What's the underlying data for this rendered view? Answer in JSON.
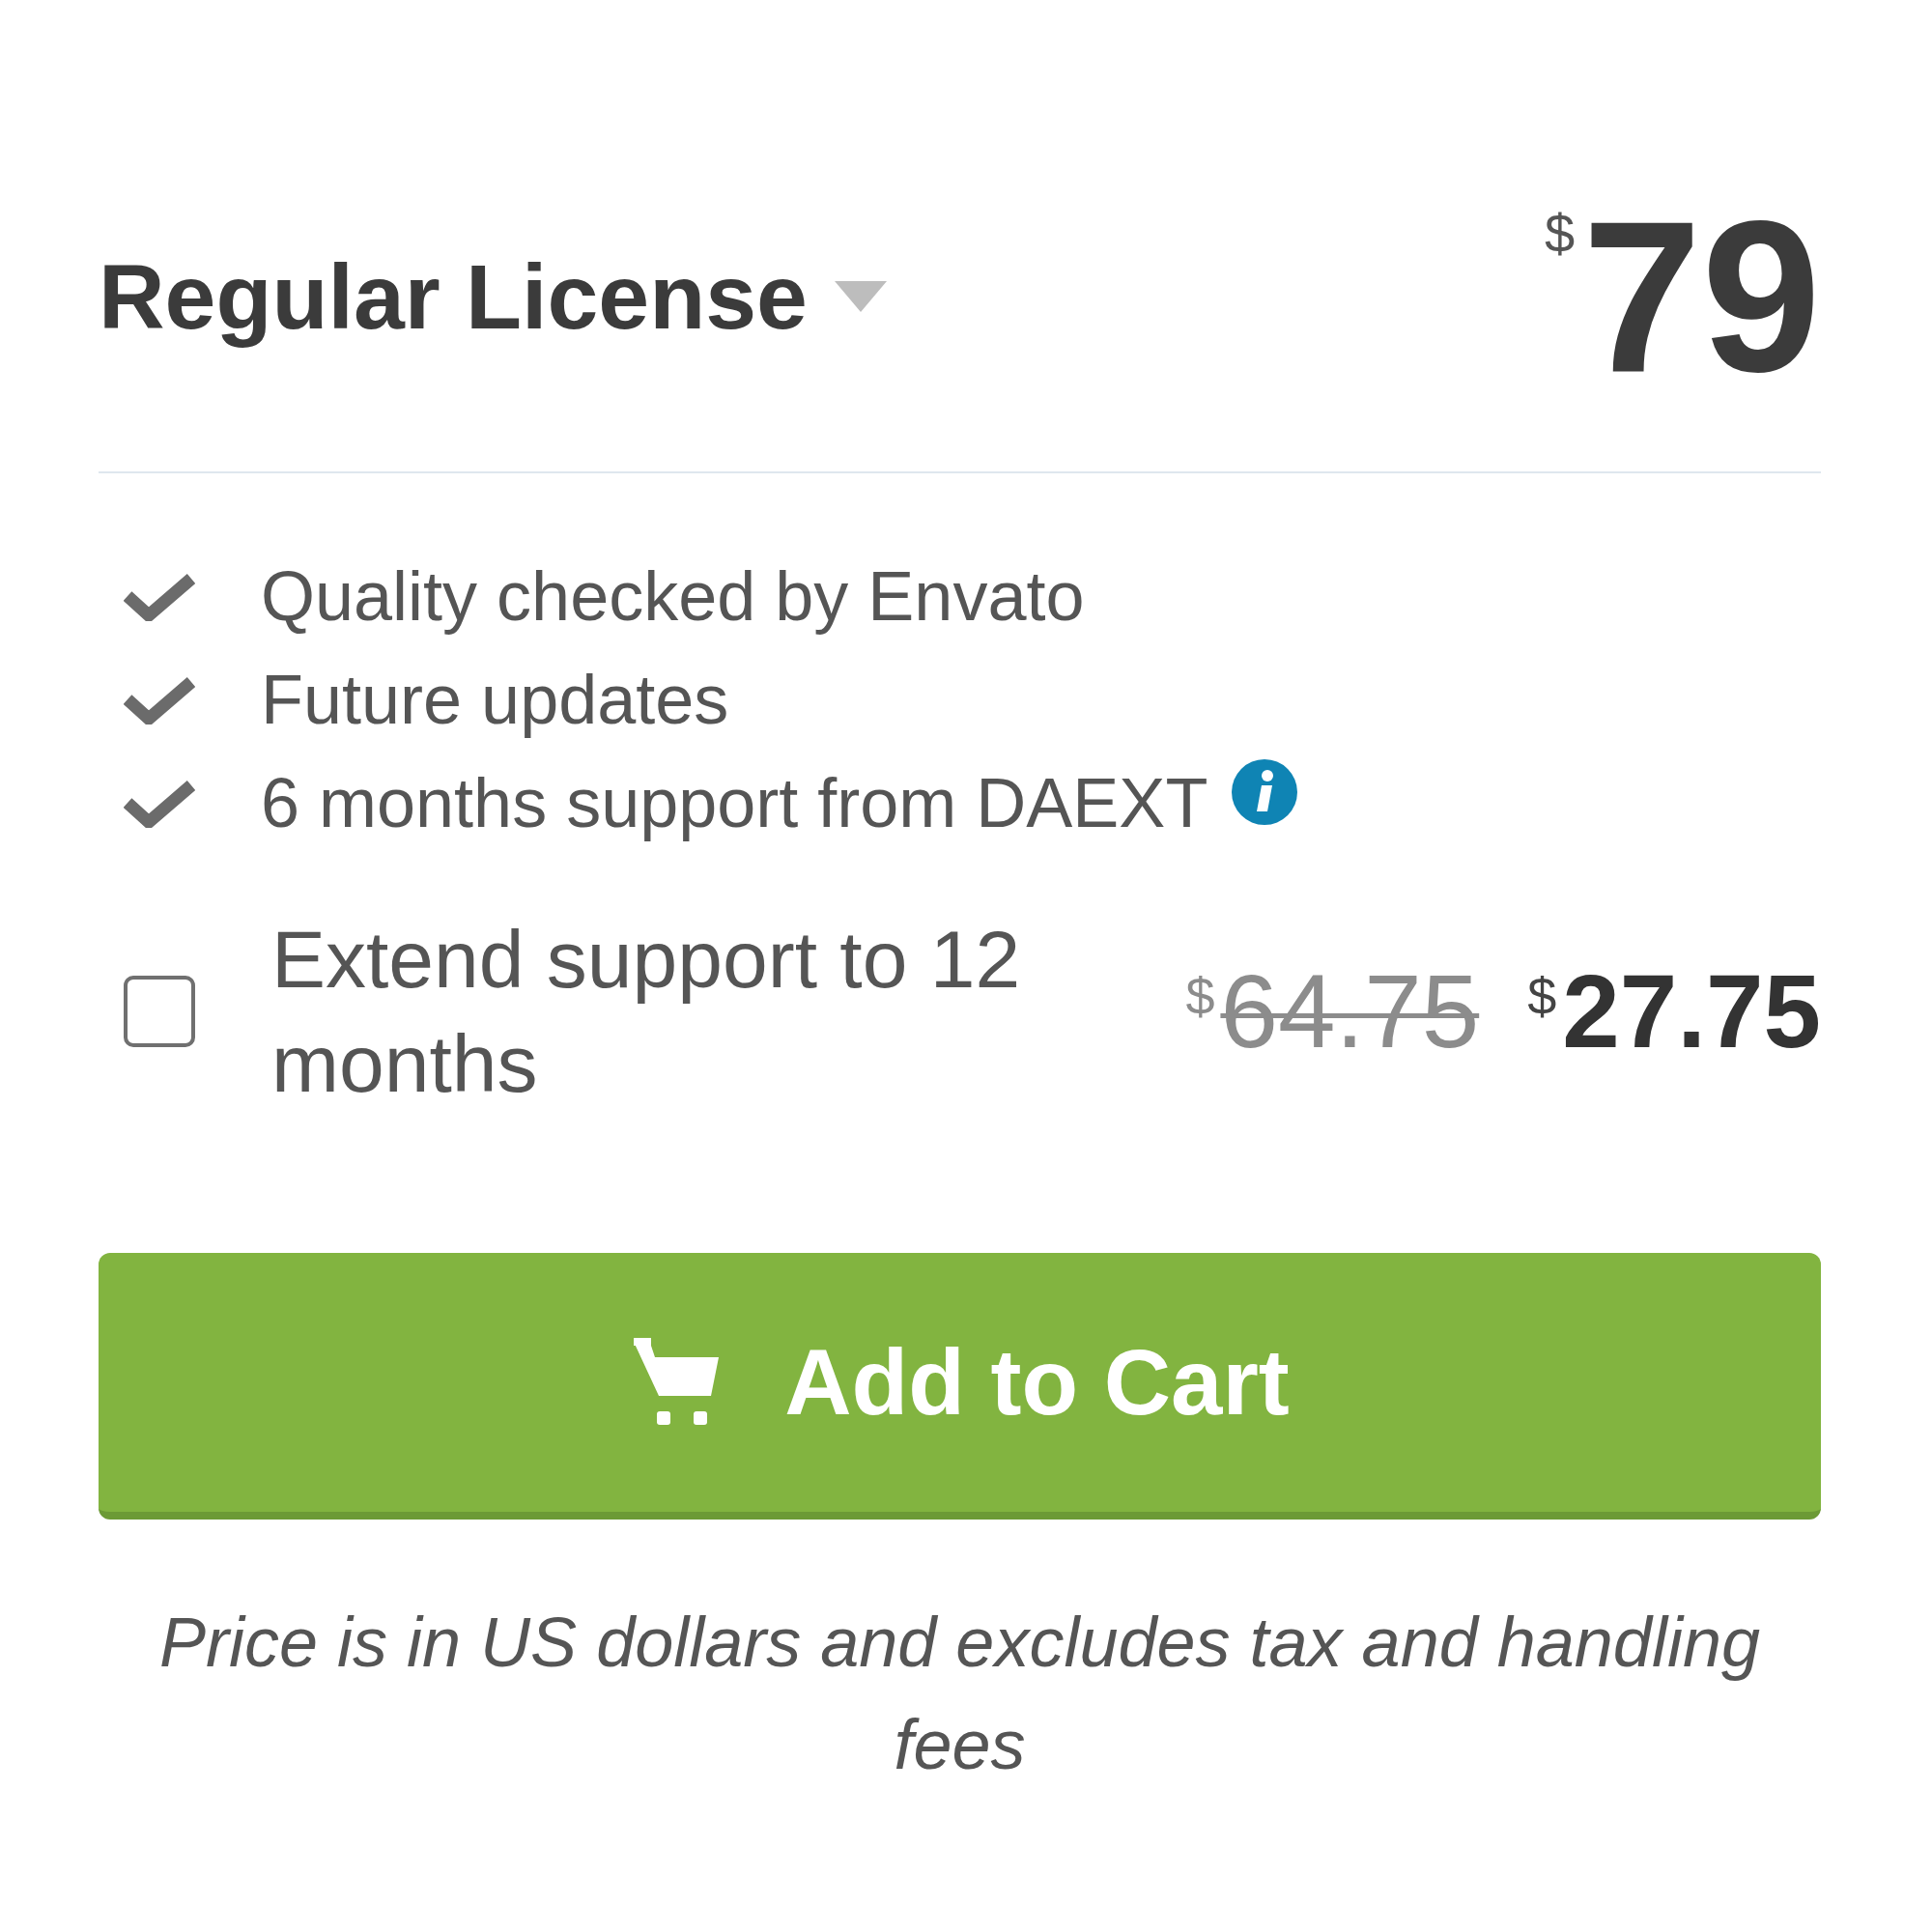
{
  "license": {
    "title": "Regular License",
    "price": {
      "currency": "$",
      "amount": "79"
    }
  },
  "features": [
    {
      "text": "Quality checked by Envato",
      "info": false
    },
    {
      "text": "Future updates",
      "info": false
    },
    {
      "text": "6 months support from DAEXT",
      "info": true
    }
  ],
  "extended_support": {
    "label": "Extend support to 12 months",
    "checked": false,
    "old_price": {
      "currency": "$",
      "amount": "64.75"
    },
    "new_price": {
      "currency": "$",
      "amount": "27.75"
    }
  },
  "add_to_cart_button": {
    "label": "Add to Cart"
  },
  "note": "Price is in US dollars and excludes tax and handling fees"
}
